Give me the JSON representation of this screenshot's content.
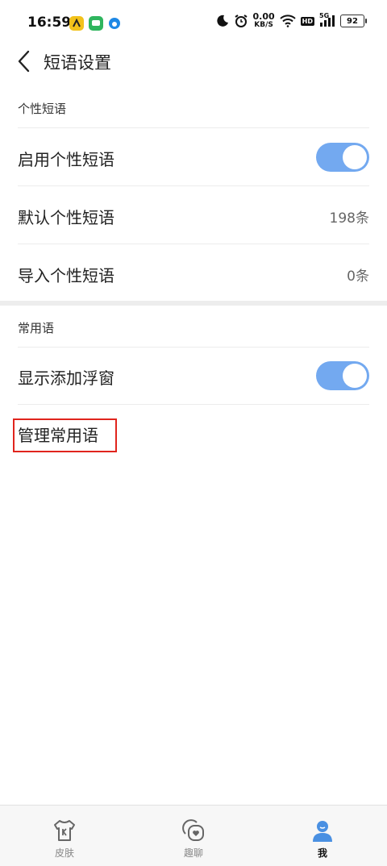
{
  "status_bar": {
    "time": "16:59",
    "speed_value": "0.00",
    "speed_unit": "KB/S",
    "hd": "HD",
    "network": "5G",
    "battery": "92"
  },
  "header": {
    "title": "短语设置"
  },
  "sections": {
    "personal": {
      "label": "个性短语",
      "enable_label": "启用个性短语",
      "enable_on": true,
      "default_label": "默认个性短语",
      "default_value": "198条",
      "import_label": "导入个性短语",
      "import_value": "0条"
    },
    "common": {
      "label": "常用语",
      "float_label": "显示添加浮窗",
      "float_on": true,
      "manage_label": "管理常用语"
    }
  },
  "bottom_nav": {
    "items": [
      {
        "label": "皮肤",
        "icon": "tshirt-icon",
        "active": false
      },
      {
        "label": "趣聊",
        "icon": "chat-heart-icon",
        "active": false
      },
      {
        "label": "我",
        "icon": "person-icon",
        "active": true
      }
    ]
  },
  "colors": {
    "accent": "#73a9f0",
    "highlight": "#e0241d"
  }
}
